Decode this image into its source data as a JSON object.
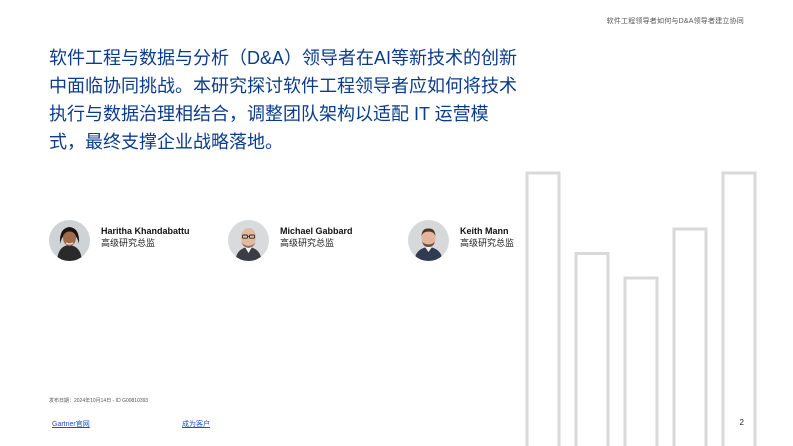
{
  "header": {
    "running_title": "软件工程领导者如何与D&A领导者建立协同"
  },
  "intro": {
    "text": "软件工程与数据与分析（D&A）领导者在AI等新技术的创新中面临协同挑战。本研究探讨软件工程领导者应如何将技术执行与数据治理相结合，调整团队架构以适配 IT 运营模式，最终支撑企业战略落地。"
  },
  "authors": [
    {
      "name": "Haritha Khandabattu",
      "title": "高级研究总监"
    },
    {
      "name": "Michael Gabbard",
      "title": "高级研究总监"
    },
    {
      "name": "Keith Mann",
      "title": "高级研究总监"
    }
  ],
  "decoration": {
    "bar_levels": [
      0.78,
      0.55,
      0.48,
      0.62,
      0.79
    ],
    "bar_color": "#d9d9d9"
  },
  "publication": {
    "info": "发布日期：2024年10月14日 - ID G00810393"
  },
  "footer": {
    "link_gartner": "Gartner官网",
    "link_client": "成为客户",
    "page_number": "2"
  },
  "colors": {
    "accent": "#0b3c8c",
    "link": "#1a4fd0"
  }
}
